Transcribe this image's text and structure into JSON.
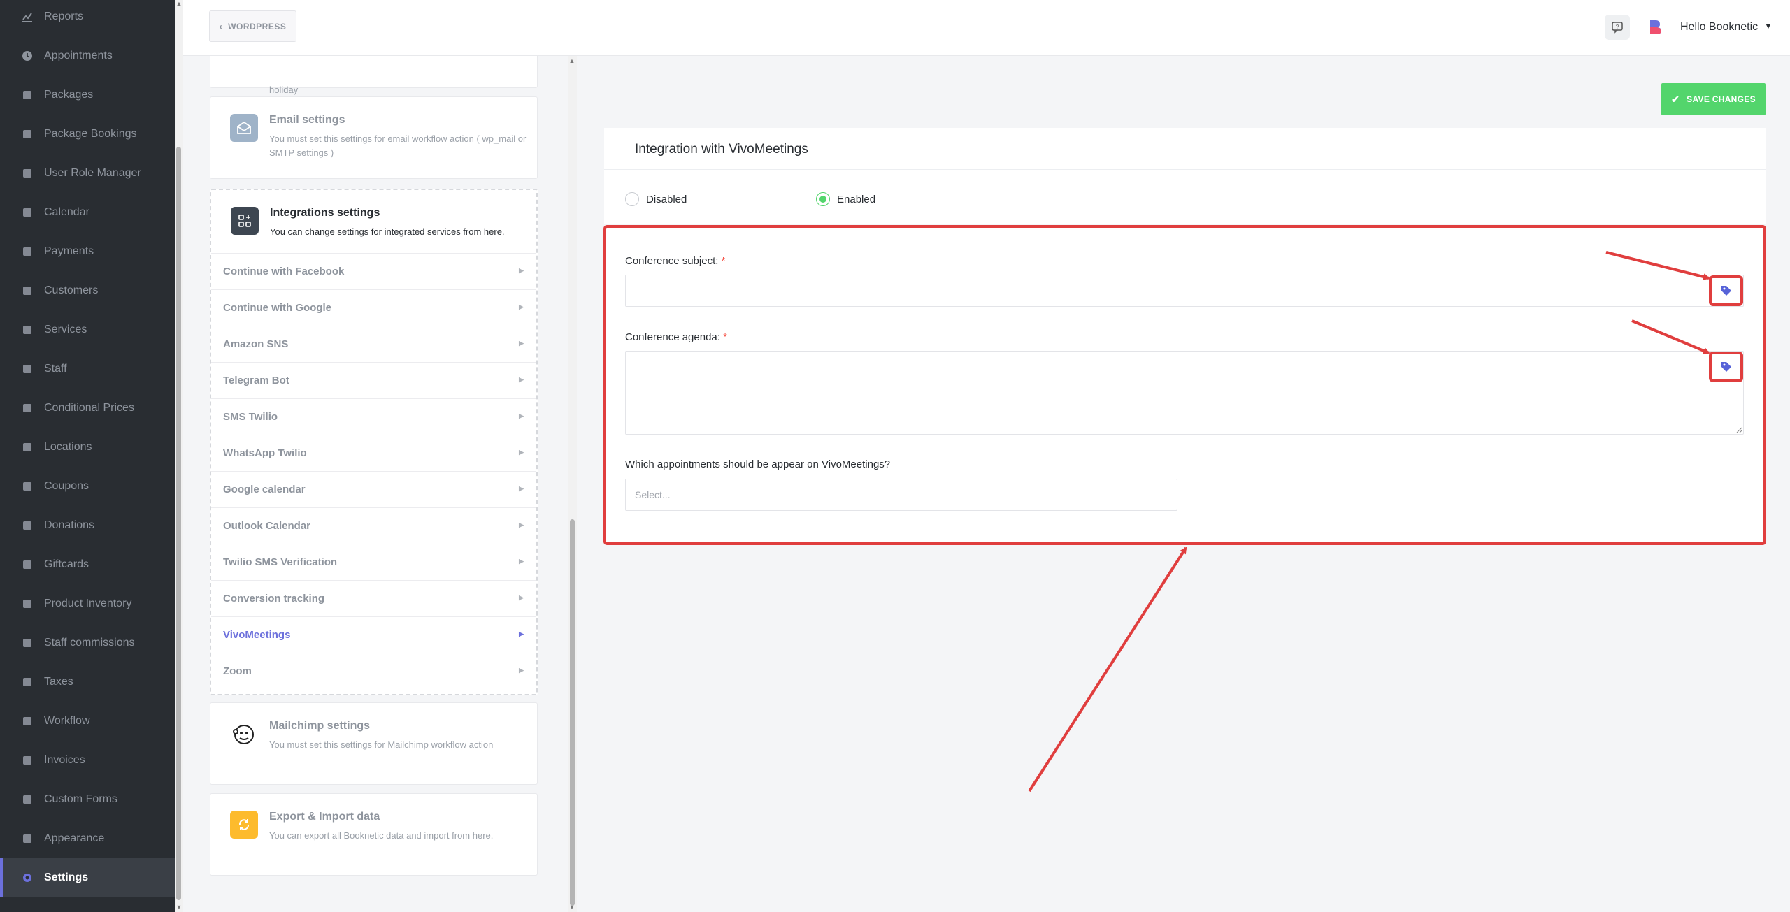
{
  "sidebar": {
    "items": [
      {
        "label": "Reports",
        "icon": "chart-icon"
      },
      {
        "label": "Appointments",
        "icon": "clock-icon"
      },
      {
        "label": "Packages",
        "icon": "packages-icon"
      },
      {
        "label": "Package Bookings",
        "icon": "package-bookings-icon"
      },
      {
        "label": "User Role Manager",
        "icon": "user-role-icon"
      },
      {
        "label": "Calendar",
        "icon": "calendar-icon"
      },
      {
        "label": "Payments",
        "icon": "payments-icon"
      },
      {
        "label": "Customers",
        "icon": "customers-icon"
      },
      {
        "label": "Services",
        "icon": "services-icon"
      },
      {
        "label": "Staff",
        "icon": "staff-icon"
      },
      {
        "label": "Conditional Prices",
        "icon": "conditional-prices-icon"
      },
      {
        "label": "Locations",
        "icon": "locations-icon"
      },
      {
        "label": "Coupons",
        "icon": "coupons-icon"
      },
      {
        "label": "Donations",
        "icon": "donations-icon"
      },
      {
        "label": "Giftcards",
        "icon": "giftcards-icon"
      },
      {
        "label": "Product Inventory",
        "icon": "product-inventory-icon"
      },
      {
        "label": "Staff commissions",
        "icon": "staff-commissions-icon"
      },
      {
        "label": "Taxes",
        "icon": "taxes-icon"
      },
      {
        "label": "Workflow",
        "icon": "workflow-icon"
      },
      {
        "label": "Invoices",
        "icon": "invoices-icon"
      },
      {
        "label": "Custom Forms",
        "icon": "custom-forms-icon"
      },
      {
        "label": "Appearance",
        "icon": "appearance-icon"
      },
      {
        "label": "Settings",
        "icon": "gear-icon",
        "active": true
      }
    ]
  },
  "topbar": {
    "back_label": "WORDPRESS",
    "user_greeting": "Hello Booknetic"
  },
  "settings": {
    "holiday_fragment": "holiday",
    "email": {
      "title": "Email settings",
      "desc": "You must set this settings for email workflow action ( wp_mail or SMTP settings )"
    },
    "integrations": {
      "title": "Integrations settings",
      "desc": "You can change settings for integrated services from here.",
      "items": [
        "Continue with Facebook",
        "Continue with Google",
        "Amazon SNS",
        "Telegram Bot",
        "SMS Twilio",
        "WhatsApp Twilio",
        "Google calendar",
        "Outlook Calendar",
        "Twilio SMS Verification",
        "Conversion tracking",
        "VivoMeetings",
        "Zoom"
      ],
      "active_item": "VivoMeetings"
    },
    "mailchimp": {
      "title": "Mailchimp settings",
      "desc": "You must set this settings for Mailchimp workflow action"
    },
    "export": {
      "title": "Export & Import data",
      "desc": "You can export all Booknetic data and import from here."
    }
  },
  "content": {
    "save_label": "SAVE CHANGES",
    "title": "Integration with VivoMeetings",
    "radio_disabled": "Disabled",
    "radio_enabled": "Enabled",
    "selected_radio": "Enabled",
    "subject_label": "Conference subject:",
    "agenda_label": "Conference agenda:",
    "required_mark": "*",
    "appointments_label": "Which appointments should be appear on VivoMeetings?",
    "select_placeholder": "Select..."
  },
  "colors": {
    "sidebar_bg": "#292d32",
    "accent": "#6c70dc",
    "success": "#53d56c",
    "annotation_red": "#e03e3e"
  }
}
